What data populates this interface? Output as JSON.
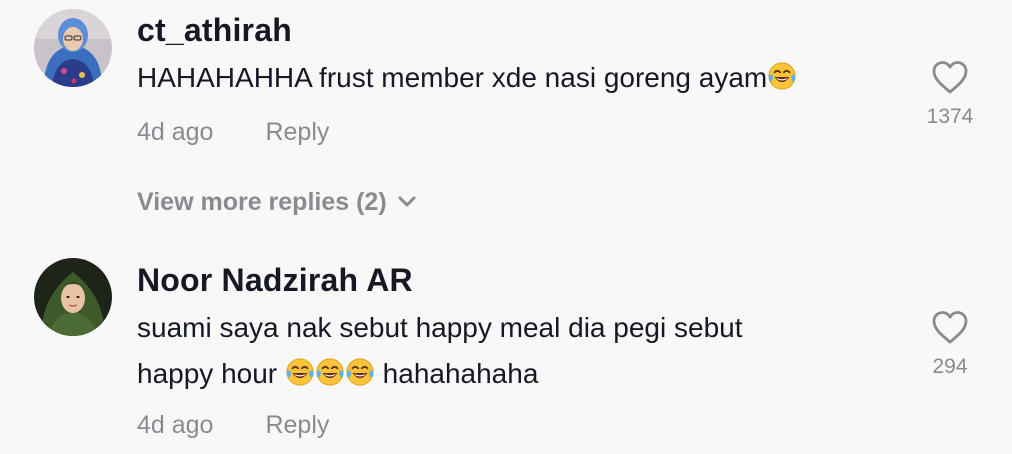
{
  "comments": [
    {
      "username": "ct_athirah",
      "text_parts": [
        "HAHAHAHHA frust member xde nasi goreng ayam"
      ],
      "emoji": "face-with-tears-of-joy",
      "time": "4d ago",
      "reply_label": "Reply",
      "likes": "1374"
    },
    {
      "username": "Noor Nadzirah AR",
      "text_line1": "suami saya nak sebut happy meal dia pegi sebut",
      "text_line2_start": "happy hour ",
      "text_line2_end": " hahahahaha",
      "emoji": "face-with-tears-of-joy",
      "time": "4d ago",
      "reply_label": "Reply",
      "likes": "294"
    }
  ],
  "view_more_replies": "View more replies (2)",
  "colors": {
    "background": "#f8f8f8",
    "primary_text": "#161823",
    "secondary_text": "#8a8b91"
  }
}
